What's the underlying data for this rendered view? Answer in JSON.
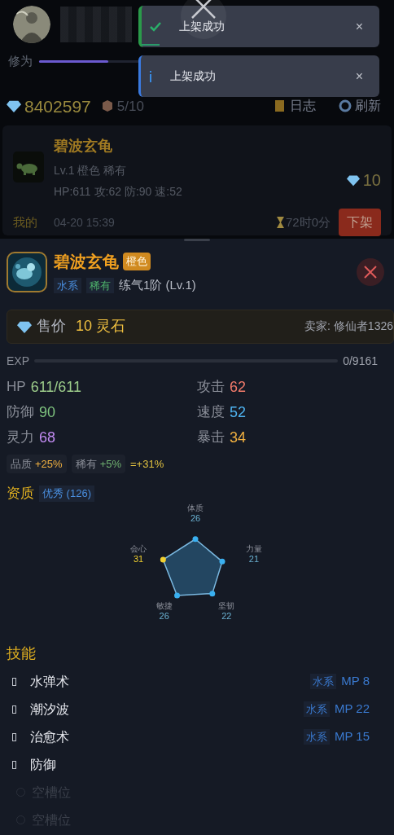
{
  "header": {
    "cultivation": {
      "label": "修为",
      "level": 0.5
    },
    "currency": "8402597",
    "bag": "5/10",
    "buttons": [
      {
        "kind": "log",
        "label": "日志"
      },
      {
        "kind": "refresh",
        "label": "刷新"
      }
    ]
  },
  "toasts": [
    {
      "kind": "success",
      "text": "上架成功",
      "close": "×"
    },
    {
      "kind": "info",
      "text": "上架成功",
      "close": "×"
    }
  ],
  "listing": {
    "name": "碧波玄龟",
    "sub": "Lv.1 橙色 稀有",
    "stats": "HP:611 攻:62 防:90 速:52",
    "price": "10",
    "owner": "我的",
    "time": "04-20 15:39",
    "remaining": "72时0分",
    "button": "下架"
  },
  "detail": {
    "name": "碧波玄龟",
    "quality": "橙色",
    "tags": [
      {
        "text": "水系",
        "color": "#4a8fe0"
      },
      {
        "text": "稀有",
        "color": "#4caf6a"
      }
    ],
    "realm": "练气1阶 (Lv.1)",
    "price_label": "售价",
    "price": "10 灵石",
    "seller": "卖家: 修仙者1326",
    "exp": {
      "label": "EXP",
      "level": 0,
      "reading": "0/9161"
    },
    "stats": [
      {
        "label": "HP",
        "value": "611/611",
        "color": "#9ccc8a"
      },
      {
        "label": "攻击",
        "value": "62",
        "color": "#f07a6a"
      },
      {
        "label": "防御",
        "value": "90",
        "color": "#7fc47f"
      },
      {
        "label": "速度",
        "value": "52",
        "color": "#4fb3f0"
      },
      {
        "label": "灵力",
        "value": "68",
        "color": "#c08af0"
      },
      {
        "label": "暴击",
        "value": "34",
        "color": "#f0b040"
      }
    ],
    "bonuses": [
      {
        "label": "品质",
        "value": "+25%",
        "color": "#f0b040"
      },
      {
        "label": "稀有",
        "value": "+5%",
        "color": "#6fb06f"
      }
    ],
    "bonus_total": "=+31%",
    "aptitude": {
      "title": "资质",
      "grade": "优秀 (126)",
      "axes": [
        {
          "label": "体质",
          "value": "26",
          "highlight": false
        },
        {
          "label": "力量",
          "value": "21",
          "highlight": false
        },
        {
          "label": "坚韧",
          "value": "22",
          "highlight": false
        },
        {
          "label": "敏捷",
          "value": "26",
          "highlight": false
        },
        {
          "label": "会心",
          "value": "31",
          "highlight": true
        }
      ]
    },
    "skills_title": "技能",
    "skills": [
      {
        "kind": "skill",
        "name": "水弹术",
        "element": "水系",
        "mp": "MP 8"
      },
      {
        "kind": "skill",
        "name": "潮汐波",
        "element": "水系",
        "mp": "MP 22"
      },
      {
        "kind": "skill",
        "name": "治愈术",
        "element": "水系",
        "mp": "MP 15"
      },
      {
        "kind": "skill",
        "name": "防御"
      },
      {
        "kind": "empty",
        "name": "空槽位"
      },
      {
        "kind": "empty",
        "name": "空槽位"
      }
    ]
  }
}
